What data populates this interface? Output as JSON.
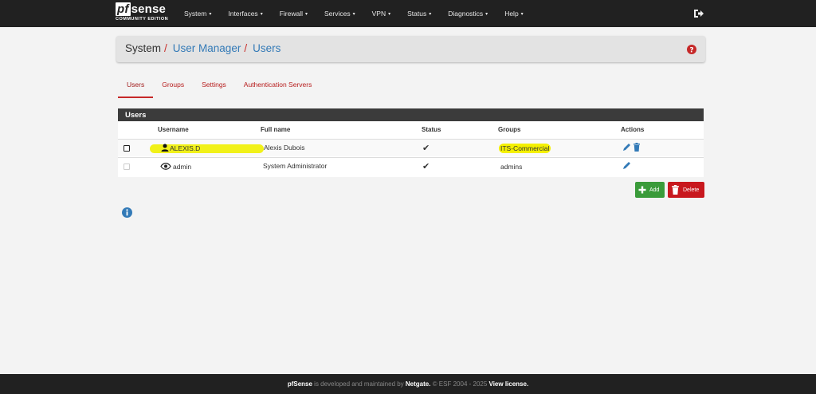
{
  "navbar": {
    "logo_main": "sense",
    "logo_pf": "pf",
    "logo_sub": "COMMUNITY EDITION",
    "items": [
      {
        "label": "System"
      },
      {
        "label": "Interfaces"
      },
      {
        "label": "Firewall"
      },
      {
        "label": "Services"
      },
      {
        "label": "VPN"
      },
      {
        "label": "Status"
      },
      {
        "label": "Diagnostics"
      },
      {
        "label": "Help"
      }
    ],
    "logout_icon": "sign-out-icon"
  },
  "breadcrumb": {
    "items": [
      "System",
      "User Manager",
      "Users"
    ],
    "separator": "/",
    "help_icon": "question-circle-icon"
  },
  "tabs": [
    {
      "label": "Users",
      "active": true
    },
    {
      "label": "Groups"
    },
    {
      "label": "Settings"
    },
    {
      "label": "Authentication Servers"
    }
  ],
  "users_table": {
    "title": "Users",
    "columns": [
      "Username",
      "Full name",
      "Status",
      "Groups",
      "Actions"
    ],
    "rows": [
      {
        "username": "ALEXIS.D",
        "fullname": "Alexis Dubois",
        "status": "✔",
        "groups": "ITS-Commercial",
        "user_icon": "user-icon",
        "highlighted": true
      },
      {
        "username": "admin",
        "fullname": "System Administrator",
        "status": "✔",
        "groups": "admins",
        "user_icon": "eye-icon",
        "highlighted": false
      }
    ]
  },
  "buttons": {
    "add": "Add",
    "delete": "Delete"
  },
  "footer": {
    "product": "pfSense",
    "text1": " is developed and maintained by ",
    "company": "Netgate.",
    "text2": " © ESF 2004 - 2025 ",
    "license": "View license."
  },
  "colors": {
    "navbar": "#212121",
    "accent_red": "#c62828",
    "link_blue": "#337ab7",
    "add_green": "#3a9b3a",
    "highlight": "#f4f000"
  }
}
